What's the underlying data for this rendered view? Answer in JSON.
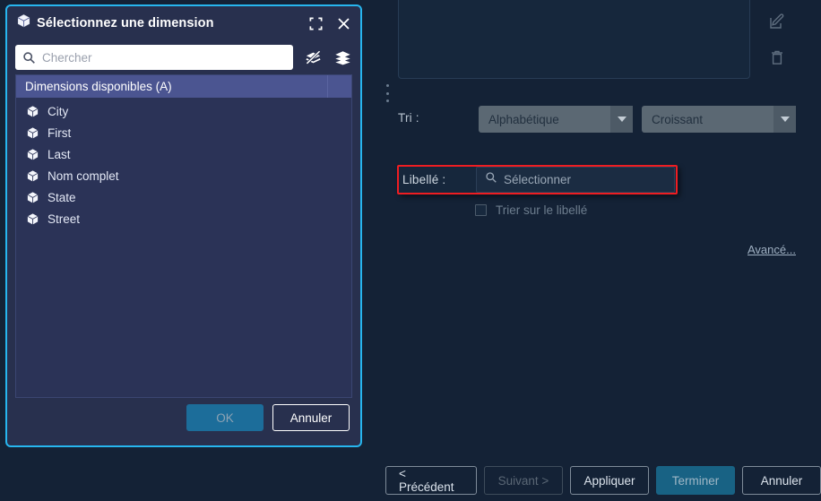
{
  "background": {
    "side_icons": [
      {
        "name": "edit-icon",
        "glyph": "pencil"
      },
      {
        "name": "delete-icon",
        "glyph": "trash"
      }
    ],
    "sort_row": {
      "label": "Tri :",
      "criteria_value": "Alphabétique",
      "direction_value": "Croissant"
    },
    "label_row": {
      "label": "Libellé :",
      "field_placeholder": "Sélectionner",
      "search_icon": "search-icon"
    },
    "sort_on_label_checkbox": {
      "label": "Trier sur le libellé",
      "checked": false
    },
    "advanced_link": "Avancé...",
    "wizard_buttons": [
      {
        "label": "< Précédent",
        "state": "enabled"
      },
      {
        "label": "Suivant >",
        "state": "disabled"
      },
      {
        "label": "Appliquer",
        "state": "enabled"
      },
      {
        "label": "Terminer",
        "state": "primary"
      },
      {
        "label": "Annuler",
        "state": "enabled"
      }
    ]
  },
  "dialog": {
    "title": "Sélectionnez une dimension",
    "title_icon": "cube-icon",
    "titlebar_actions": [
      {
        "name": "maximize-icon"
      },
      {
        "name": "close-icon"
      }
    ],
    "search": {
      "placeholder": "Chercher",
      "value": "",
      "icon": "search-icon"
    },
    "toolbar_icons": [
      {
        "name": "hide-layers-icon"
      },
      {
        "name": "layers-icon"
      }
    ],
    "list": {
      "header": "Dimensions disponibles (A)",
      "items": [
        {
          "label": "City",
          "icon": "cube-icon"
        },
        {
          "label": "First",
          "icon": "cube-icon"
        },
        {
          "label": "Last",
          "icon": "cube-icon"
        },
        {
          "label": "Nom complet",
          "icon": "cube-icon"
        },
        {
          "label": "State",
          "icon": "cube-icon"
        },
        {
          "label": "Street",
          "icon": "cube-icon"
        }
      ]
    },
    "footer": {
      "ok_label": "OK",
      "cancel_label": "Annuler"
    }
  },
  "colors": {
    "dialog_border": "#27b6ef",
    "dialog_bg": "#28304e",
    "list_header": "#4b5591",
    "highlight_box": "#ef1d22",
    "primary_button": "#186284",
    "ok_button": "#1c6d9a",
    "page_bg": "#142236"
  }
}
